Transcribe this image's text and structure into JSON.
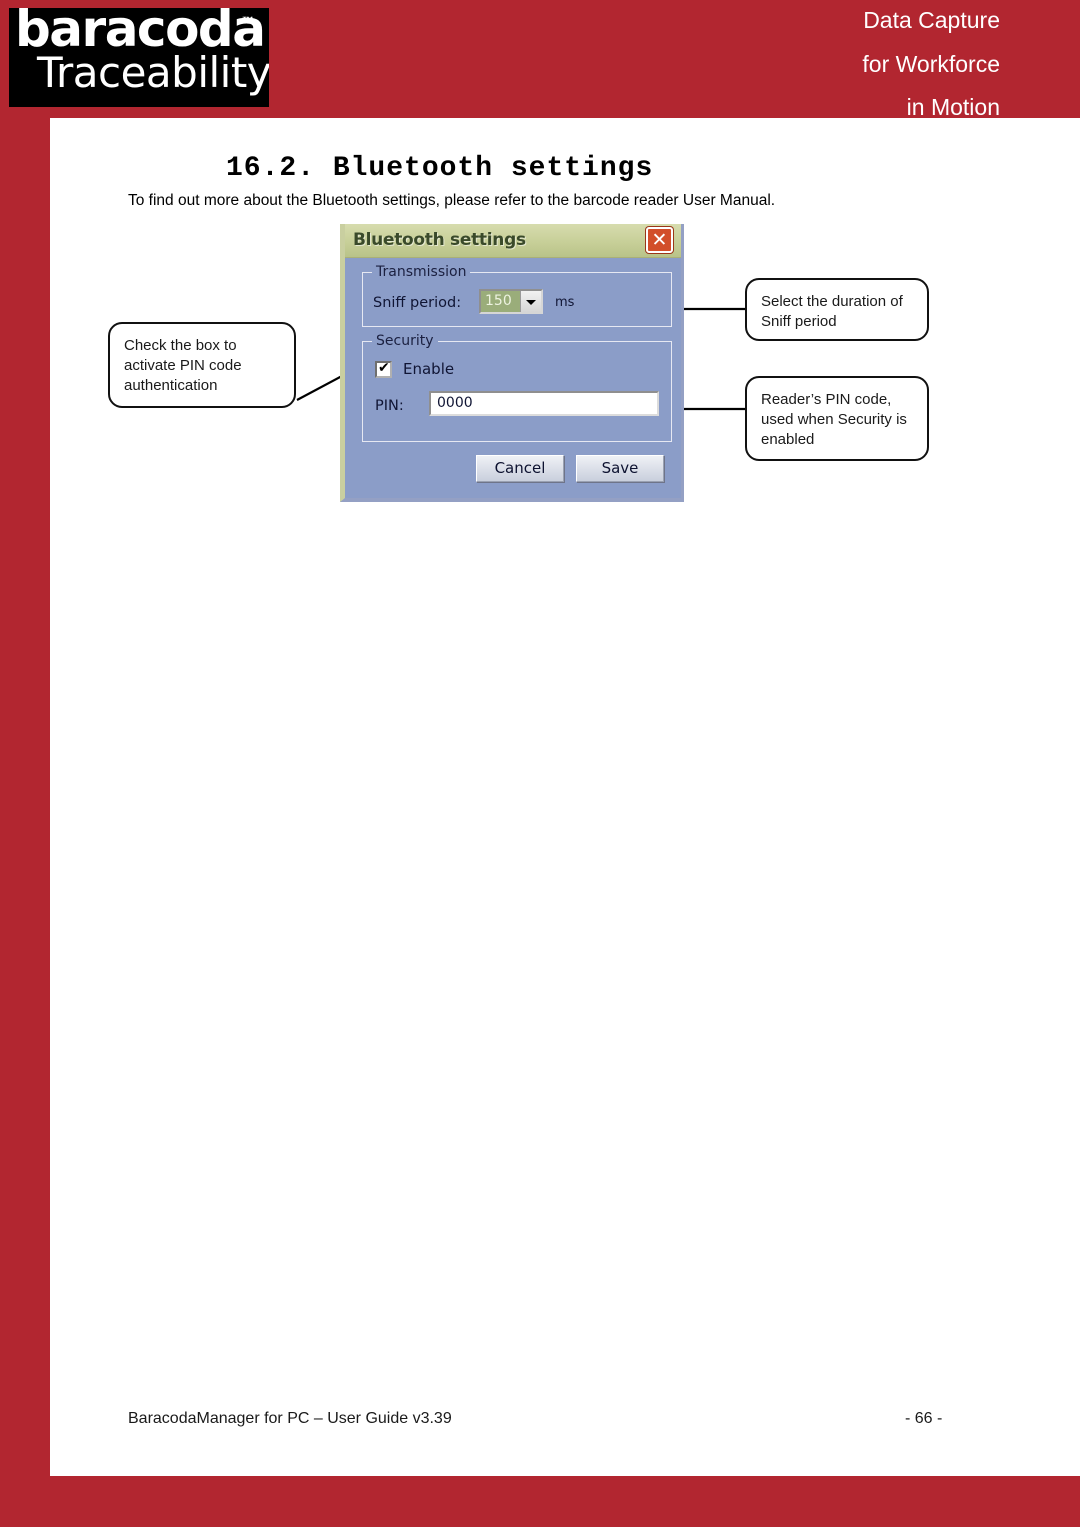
{
  "header": {
    "logo": {
      "brand": "baracoda",
      "trademark": "™",
      "subbrand": "Traceability"
    },
    "tagline_line_1": "Data Capture",
    "tagline_line_2": "for Workforce",
    "tagline_line_3": "in Motion",
    "brand_red": "#b22630"
  },
  "content": {
    "section_heading": "16.2. Bluetooth settings",
    "intro_paragraph": "To find out more about the Bluetooth settings, please refer to the barcode reader User Manual."
  },
  "dialog": {
    "title": "Bluetooth settings",
    "close_icon": "✕",
    "transmission": {
      "legend": "Transmission",
      "sniff_period_label": "Sniff period:",
      "sniff_period_value": "150",
      "sniff_period_unit": "ms",
      "dropdown_icon": "chevron-down-icon"
    },
    "security": {
      "legend": "Security",
      "enable_label": "Enable",
      "enable_checked": true,
      "check_glyph": "✔",
      "pin_label": "PIN:",
      "pin_value": "0000"
    },
    "buttons": {
      "cancel": "Cancel",
      "save": "Save"
    },
    "colors": {
      "titlebar": "#c7cf98",
      "body": "#8b9dc8",
      "close_button": "#d24e2a",
      "combo_value_bg": "#9aad7a"
    }
  },
  "callouts": {
    "pin_activate": "Check the box to activate PIN code authentication",
    "sniff_duration": "Select the duration of Sniff period",
    "pin_code": "Reader’s PIN code, used when Security is enabled"
  },
  "footer": {
    "document_title": "BaracodaManager for PC – User Guide v3.39",
    "page_number": "- 66 -"
  }
}
